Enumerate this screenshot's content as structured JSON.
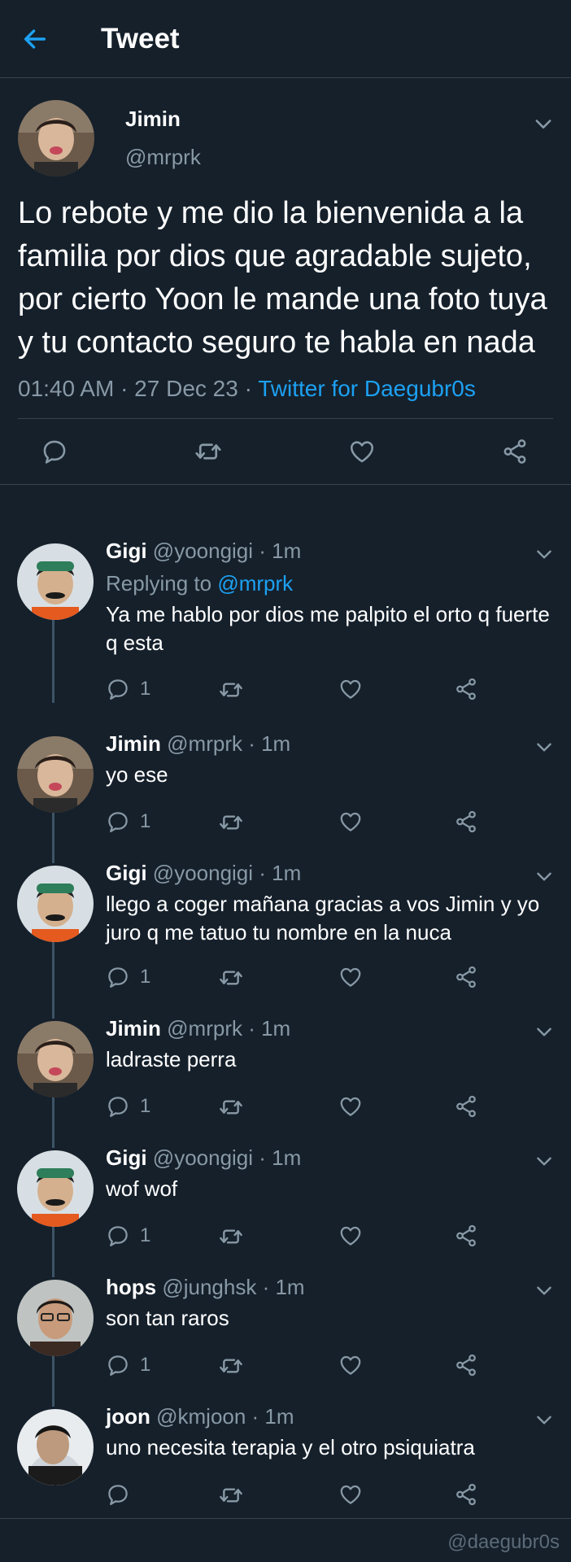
{
  "header": {
    "title": "Tweet",
    "back_icon": "arrow-left-icon",
    "accent": "#1da1f2"
  },
  "main_tweet": {
    "name": "Jimin",
    "handle": "@mrprk",
    "text": "Lo rebote y me dio la bienvenida a la familia por dios que agradable sujeto, por cierto Yoon le mande una foto tuya y tu contacto seguro te habla en nada",
    "time": "01:40 AM · 27 Dec 23 · ",
    "source": "Twitter for Daegubr0s",
    "actions": [
      "reply-icon",
      "retweet-icon",
      "like-icon",
      "share-icon"
    ]
  },
  "replies": [
    {
      "name": "Gigi",
      "handle": "@yoongigi",
      "time": " · 1m",
      "replying_prefix": "Replying to ",
      "replying_to": "@mrprk",
      "text": "Ya me hablo por dios me palpito el orto q fuerte q esta",
      "reply_count": "1"
    },
    {
      "name": "Jimin",
      "handle": "@mrprk",
      "time": " · 1m",
      "text": "yo ese",
      "reply_count": "1"
    },
    {
      "name": "Gigi",
      "handle": "@yoongigi",
      "time": " · 1m",
      "text": "llego a coger mañana gracias a vos Jimin y yo juro q me tatuo tu nombre en la nuca",
      "reply_count": "1"
    },
    {
      "name": "Jimin",
      "handle": "@mrprk",
      "time": " · 1m",
      "text": "ladraste perra",
      "reply_count": "1"
    },
    {
      "name": "Gigi",
      "handle": "@yoongigi",
      "time": " · 1m",
      "text": "wof wof",
      "reply_count": "1"
    },
    {
      "name": "hops",
      "handle": "@junghsk",
      "time": " · 1m",
      "text": "son tan raros",
      "reply_count": "1"
    },
    {
      "name": "joon",
      "handle": "@kmjoon",
      "time": " · 1m",
      "text": "uno necesita terapia y el otro psiquiatra",
      "reply_count": ""
    }
  ],
  "watermark": "@daegubr0s",
  "colors": {
    "background": "#15202b",
    "secondary_text": "#8899a6",
    "divider": "#38444d",
    "link": "#1da1f2"
  }
}
